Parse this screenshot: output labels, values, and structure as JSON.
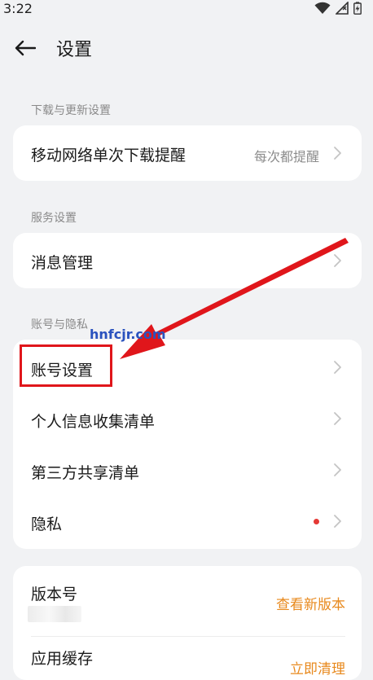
{
  "status_bar": {
    "time": "3:22"
  },
  "header": {
    "title": "设置"
  },
  "sections": [
    {
      "label": "下载与更新设置"
    },
    {
      "label": "服务设置"
    },
    {
      "label": "账号与隐私"
    }
  ],
  "download_card": {
    "row_label": "移动网络单次下载提醒",
    "row_value": "每次都提醒"
  },
  "service_card": {
    "row_label": "消息管理"
  },
  "account_card": {
    "rows": [
      {
        "label": "账号设置"
      },
      {
        "label": "个人信息收集清单"
      },
      {
        "label": "第三方共享清单"
      },
      {
        "label": "隐私",
        "has_dot": true
      }
    ]
  },
  "about_card": {
    "version_label": "版本号",
    "check_update": "查看新版本",
    "cache_label": "应用缓存",
    "clear_now": "立即清理"
  },
  "overlay": {
    "watermark": "hnfcjr.com",
    "arrow_color": "#e0161b"
  },
  "colors": {
    "accent_orange": "#e8891d",
    "notification_dot": "#e53935",
    "background": "#f1f2f4"
  }
}
